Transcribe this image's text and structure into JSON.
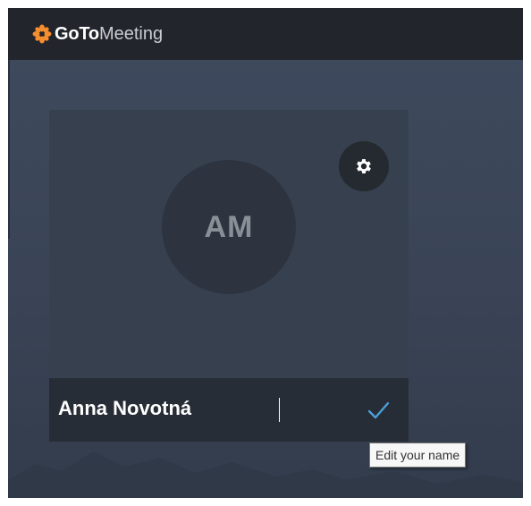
{
  "app": {
    "brand_bold": "GoTo",
    "brand_light": "Meeting",
    "logo_icon": "asterisk-flower-icon",
    "accent_color": "#f68d2e"
  },
  "preview": {
    "avatar_initials": "AM",
    "settings_icon": "gear-icon"
  },
  "name_editor": {
    "value": "Anna Novotná",
    "confirm_icon": "checkmark-icon",
    "confirm_color": "#4a9fd8",
    "tooltip": "Edit your name"
  }
}
